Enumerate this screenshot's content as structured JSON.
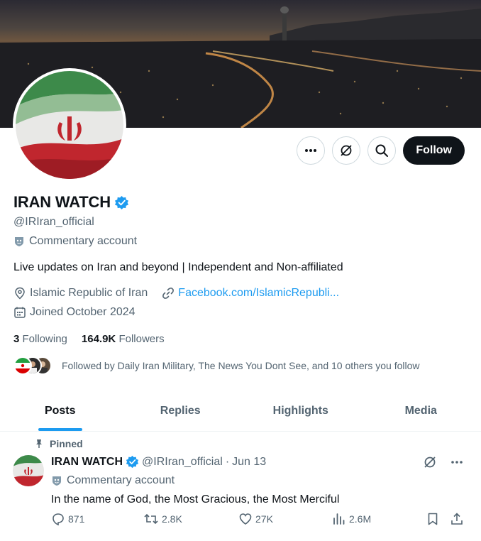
{
  "profile": {
    "name": "IRAN WATCH",
    "handle": "@IRIran_official",
    "account_label": "Commentary account",
    "bio": "Live updates on Iran and beyond | Independent and Non-affiliated",
    "location": "Islamic Republic of Iran",
    "website": "Facebook.com/IslamicRepubli...",
    "joined": "Joined October 2024",
    "following_count": "3",
    "following_label": "Following",
    "followers_count": "164.9K",
    "followers_label": "Followers",
    "followed_by": "Followed by Daily Iran Military, The News You Dont See, and 10 others you follow"
  },
  "actions": {
    "follow_label": "Follow"
  },
  "tabs": [
    {
      "label": "Posts",
      "active": true
    },
    {
      "label": "Replies",
      "active": false
    },
    {
      "label": "Highlights",
      "active": false
    },
    {
      "label": "Media",
      "active": false
    }
  ],
  "pinned_post": {
    "pinned_label": "Pinned",
    "author_name": "IRAN WATCH",
    "author_handle": "@IRIran_official",
    "separator": "·",
    "date": "Jun 13",
    "account_label": "Commentary account",
    "text": "In the name of God, the Most Gracious, the Most Merciful",
    "replies": "871",
    "reposts": "2.8K",
    "likes": "27K",
    "views": "2.6M"
  },
  "colors": {
    "accent": "#1d9bf0",
    "text_primary": "#0f1419",
    "text_secondary": "#536471",
    "button_dark": "#0f1419"
  },
  "icons": [
    "more-icon",
    "grok-icon",
    "search-icon",
    "verified-badge-icon",
    "commentary-icon",
    "location-icon",
    "link-icon",
    "calendar-icon",
    "pin-icon",
    "reply-icon",
    "repost-icon",
    "like-icon",
    "views-icon",
    "bookmark-icon",
    "share-icon"
  ]
}
